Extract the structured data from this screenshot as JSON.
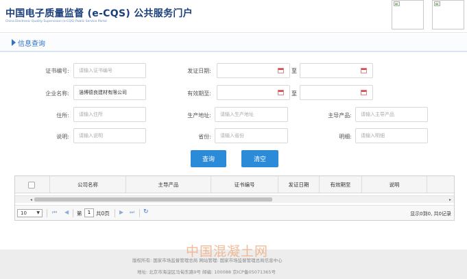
{
  "header": {
    "title": "中国电子质量监督 (e-CQS) 公共服务门户",
    "subtitle": "China Electronic Quality Supervision (e-CQS) Public Service Portal"
  },
  "section": {
    "title": "信息查询"
  },
  "form": {
    "cert_no": {
      "label": "证书编号:",
      "placeholder": "请输入证书编号"
    },
    "issue_date": {
      "label": "发证日期:",
      "to": "至"
    },
    "company": {
      "label": "企业名称:",
      "value": "淄博德良建材有限公司"
    },
    "valid_until": {
      "label": "有效期至:",
      "to": "至"
    },
    "address": {
      "label": "住所:",
      "placeholder": "请输入住所"
    },
    "prod_address": {
      "label": "生产地址:",
      "placeholder": "请输入生产地址"
    },
    "main_product": {
      "label": "主导产品:",
      "placeholder": "请输入主导产品"
    },
    "note": {
      "label": "说明:",
      "placeholder": "请输入说明"
    },
    "province": {
      "label": "省份:",
      "placeholder": "请输入省份"
    },
    "detail": {
      "label": "明细:",
      "placeholder": "请输入明细"
    }
  },
  "buttons": {
    "search": "查询",
    "clear": "清空"
  },
  "grid": {
    "columns": [
      "公司名称",
      "主导产品",
      "证书编号",
      "发证日期",
      "有效期至",
      "说明"
    ]
  },
  "pager": {
    "page_size": "10",
    "page_prefix": "第",
    "page_number": "1",
    "page_suffix": "共0页",
    "info": "显示0到0, 共0记录"
  },
  "footer": {
    "line1": "版权所有: 国家市场监督管理总局    网站管理: 国家市场监督管理总局信息中心",
    "line2": "地址: 北京市海淀区马甸东路9号    邮编: 100088    京ICP备05071365号"
  },
  "watermark": "中国混凝土网",
  "colors": {
    "accent": "#2b8bd9",
    "title": "#1a3f7a"
  }
}
